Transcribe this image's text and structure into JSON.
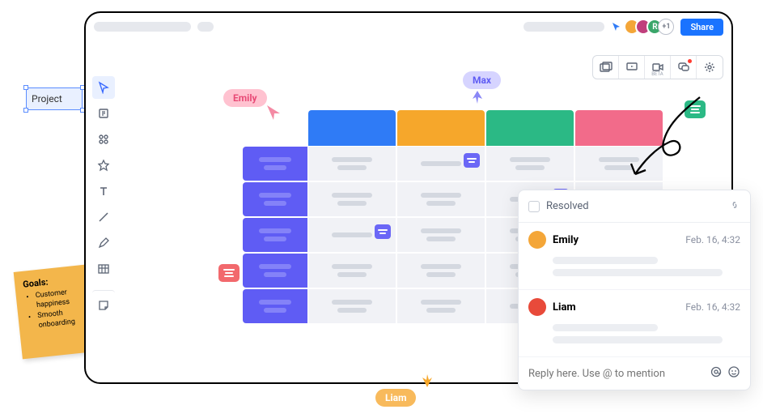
{
  "topbar": {
    "avatar_extra": "+1",
    "avatar_r": "R",
    "share_label": "Share"
  },
  "labels": {
    "emily": "Emily",
    "max": "Max",
    "liam": "Liam"
  },
  "sticky": {
    "title": "Goals:",
    "items": [
      "Customer happiness",
      "Smooth onboarding"
    ]
  },
  "project_tag": "Project",
  "comment_panel": {
    "resolved_label": "Resolved",
    "items": [
      {
        "name": "Emily",
        "timestamp": "Feb. 16, 4:32",
        "avatar_color": "#f4a638"
      },
      {
        "name": "Liam",
        "timestamp": "Feb. 16, 4:32",
        "avatar_color": "#e84a3a"
      }
    ],
    "reply_placeholder": "Reply here. Use @ to mention"
  }
}
